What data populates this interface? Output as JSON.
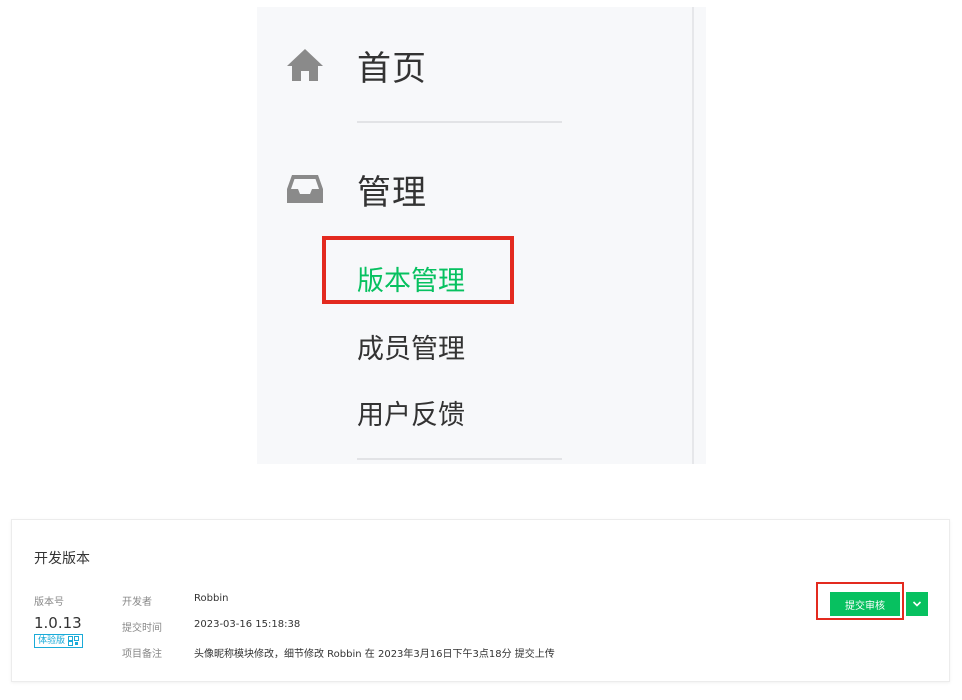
{
  "nav": {
    "home_label": "首页",
    "manage_label": "管理",
    "sub_items": [
      "版本管理",
      "成员管理",
      "用户反馈"
    ],
    "active_item": "版本管理",
    "icons": {
      "home": "home-icon",
      "manage": "inbox-icon"
    }
  },
  "version_card": {
    "title": "开发版本",
    "version_label": "版本号",
    "version_value": "1.0.13",
    "tag_label": "体验版",
    "fields": [
      {
        "label": "开发者",
        "value": "Robbin"
      },
      {
        "label": "提交时间",
        "value": "2023-03-16 15:18:38"
      },
      {
        "label": "项目备注",
        "value": "头像昵称模块修改，细节修改 Robbin 在 2023年3月16日下午3点18分 提交上传"
      }
    ],
    "submit_button": "提交审核",
    "dropdown_icon": "chevron-down-icon"
  },
  "colors": {
    "accent": "#07c160",
    "highlight": "#e32a1f",
    "tag": "#1aabd8",
    "sidebar_bg": "#f7f8fa"
  }
}
